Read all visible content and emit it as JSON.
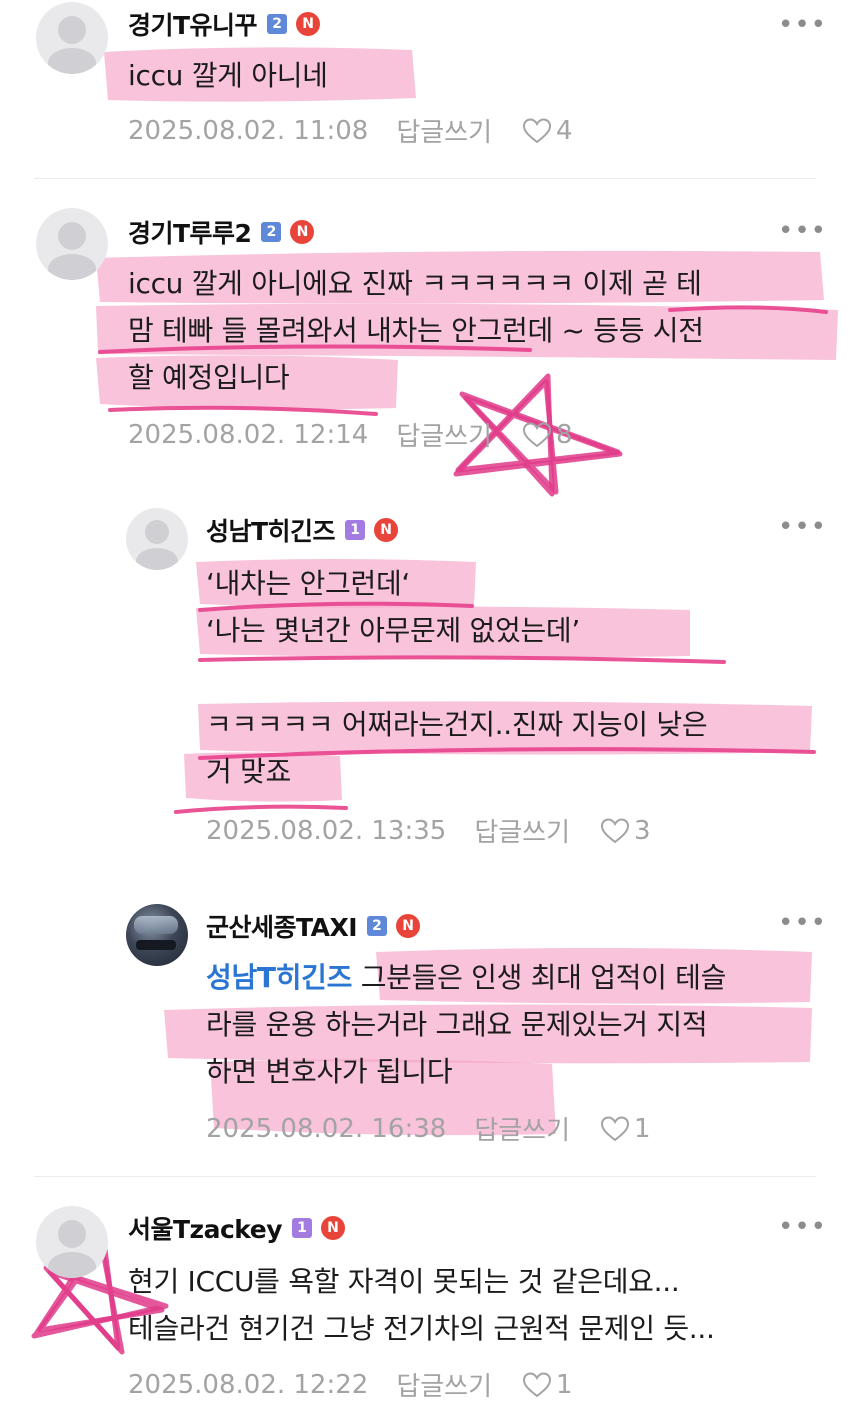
{
  "comments": [
    {
      "nickname": "경기T유니꾸",
      "level": "2",
      "badge": "N",
      "lines": [
        "iccu 깔게 아니네"
      ],
      "date": "2025.08.02. 11:08",
      "reply_label": "답글쓰기",
      "likes": "4"
    },
    {
      "nickname": "경기T루루2",
      "level": "2",
      "badge": "N",
      "lines": [
        "iccu 깔게 아니에요 진짜 ㅋㅋㅋㅋㅋㅋ 이제 곧 테",
        "맘 테빠 들 몰려와서 내차는 안그런데 ~ 등등 시전",
        "할 예정입니다"
      ],
      "date": "2025.08.02. 12:14",
      "reply_label": "답글쓰기",
      "likes": "8"
    },
    {
      "nickname": "성남T히긴즈",
      "level": "1",
      "badge": "N",
      "lines": [
        "‘내차는 안그런데‘",
        "‘나는 몇년간 아무문제 없었는데’",
        "",
        "ㅋㅋㅋㅋㅋ 어쩌라는건지..진짜 지능이 낮은",
        "거 맞죠"
      ],
      "date": "2025.08.02. 13:35",
      "reply_label": "답글쓰기",
      "likes": "3"
    },
    {
      "nickname": "군산세종TAXI",
      "level": "2",
      "badge": "N",
      "mention": "성남T히긴즈",
      "lines": [
        " 그분들은 인생 최대 업적이 테슬",
        "라를 운용 하는거라 그래요 문제있는거 지적",
        "하면 변호사가 됩니다"
      ],
      "date": "2025.08.02. 16:38",
      "reply_label": "답글쓰기",
      "likes": "1"
    },
    {
      "nickname": "서울Tzackey",
      "level": "1",
      "badge": "N",
      "lines": [
        "현기 ICCU를 욕할 자격이 못되는 것 같은데요...",
        "테슬라건 현기건 그냥 전기차의 근원적 문제인 듯..."
      ],
      "date": "2025.08.02. 12:22",
      "reply_label": "답글쓰기",
      "likes": "1"
    }
  ],
  "more_glyph": "•••",
  "colors": {
    "highlight": "#f08ab8",
    "mention": "#2a76d2",
    "badge_new": "#e8443a",
    "level_2": "#5f88d9",
    "level_1": "#a27ce0",
    "meta_text": "#a3a3a3"
  },
  "icons": [
    "default-avatar-icon",
    "heart-icon",
    "more-icon",
    "level-badge-icon",
    "new-badge-icon"
  ]
}
